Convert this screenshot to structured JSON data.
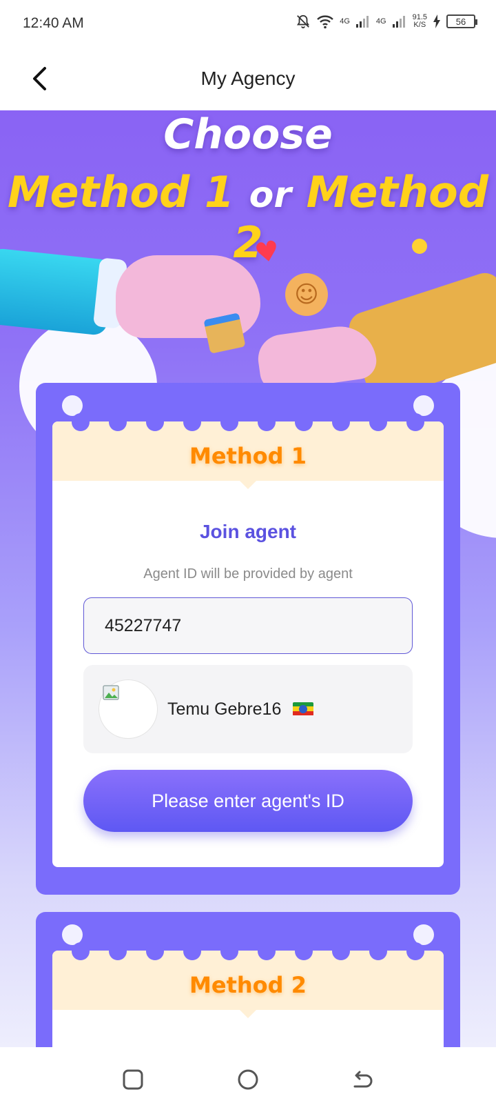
{
  "status_bar": {
    "time": "12:40 AM",
    "net1": "4G",
    "net2": "4G",
    "speed_value": "91.5",
    "speed_unit": "K/S",
    "battery": "56",
    "icons": [
      "bell-off-icon",
      "wifi-icon",
      "signal-icon",
      "charging-icon",
      "battery-icon"
    ]
  },
  "header": {
    "title": "My Agency",
    "back_icon": "chevron-left-icon"
  },
  "hero": {
    "title_line1": "Choose",
    "title_part1": "Method 1",
    "title_or": "or",
    "title_part2": "Method 2"
  },
  "method1": {
    "label": "Method 1",
    "join_title": "Join agent",
    "hint": "Agent ID will be provided by agent",
    "agent_id_value": "45227747",
    "agent_name": "Temu Gebre16",
    "flag": "ethiopia-flag-icon",
    "submit_label": "Please enter agent's ID"
  },
  "method2": {
    "label": "Method 2"
  },
  "nav_bar": {
    "icons": [
      "recents-icon",
      "home-icon",
      "back-icon"
    ]
  },
  "colors": {
    "accent": "#7a6cfb",
    "title_yellow": "#ffd21a",
    "method_orange": "#ff8a00",
    "banner_cream": "#fff0d6",
    "button_purple": "#5e58f3"
  }
}
